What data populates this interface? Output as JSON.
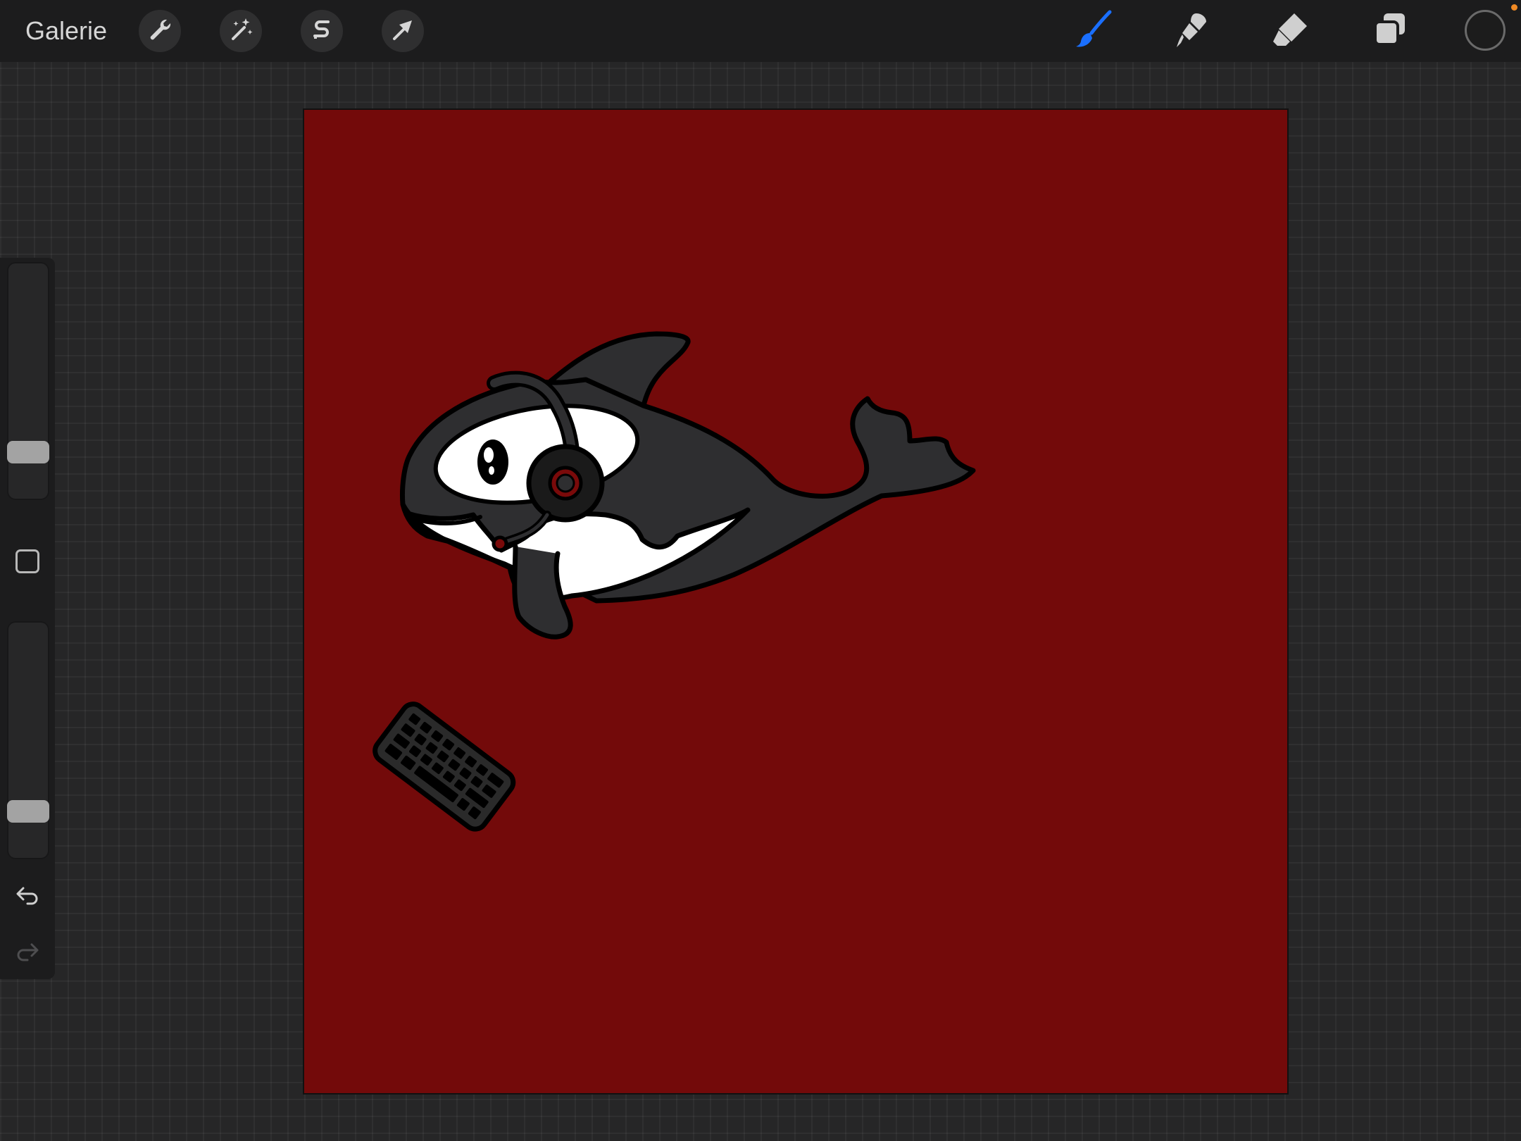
{
  "topbar": {
    "gallery_label": "Galerie",
    "tools": [
      "wrench-icon",
      "magic-wand-icon",
      "selection-s-icon",
      "transform-arrow-icon"
    ],
    "right_tools": [
      "brush-icon",
      "smudge-icon",
      "eraser-icon",
      "layers-icon"
    ],
    "active_tool": "brush-icon",
    "active_color": "#1a6fff",
    "current_color": "#1c1c1c",
    "notification_color": "#f08a24"
  },
  "sidebar": {
    "brush_size": 0.17,
    "opacity": 0.17,
    "modify_icon": "square-icon",
    "undo_icon": "undo-arrow-icon",
    "redo_icon": "redo-arrow-icon"
  },
  "canvas": {
    "background_color": "#730a0a",
    "content": "orca-with-headset-and-keyboard-illustration"
  }
}
